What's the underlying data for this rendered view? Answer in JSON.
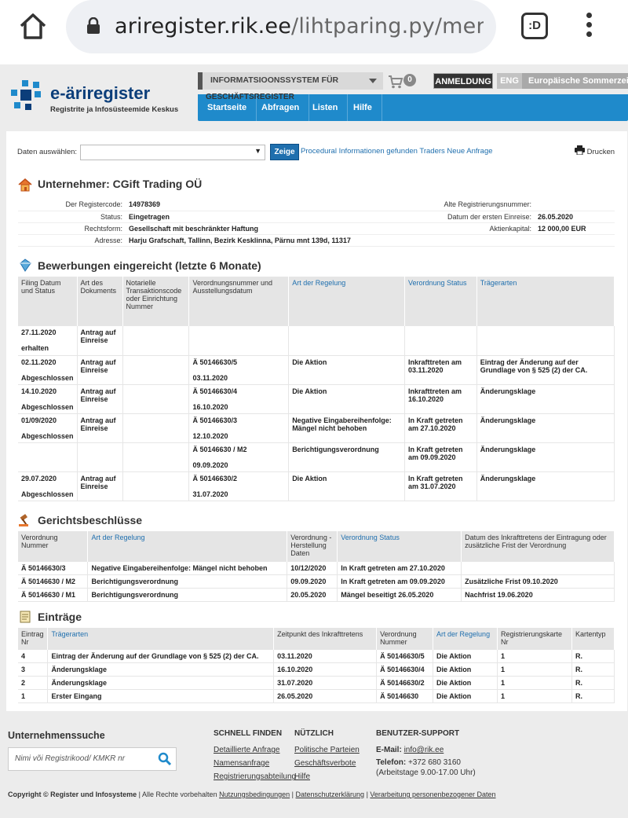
{
  "browser": {
    "url_host": "ariregister.rik.ee",
    "url_path": "/lihtparing.py/menet",
    "tabs_label": ":D"
  },
  "header": {
    "logo_title": "e-äriregister",
    "logo_subtitle": "Registrite ja Infosüsteemide Keskus",
    "system_select": "INFORMATSIOONSSYSTEM FÜR",
    "system_overflow": "GESCHÄFTSREGISTER",
    "cart_count": "0",
    "login_label": "ANMELDUNG",
    "lang_label": "ENG",
    "timezone_label": "Europäische Sommerzeit",
    "nav": [
      "Startseite",
      "Abfragen",
      "Listen",
      "Hilfe"
    ]
  },
  "toolbar": {
    "select_label": "Daten auswählen:",
    "select_value": "",
    "show_label": "Zeige",
    "links": "Procedural Informationen gefunden Traders Neue Anfrage",
    "print_label": "Drucken"
  },
  "company": {
    "title": "Unternehmer: CGift Trading OÜ",
    "rows": [
      {
        "l1": "Der Registercode:",
        "v1": "14978369",
        "l2": "Alte Registrierungsnummer:",
        "v2": ""
      },
      {
        "l1": "Status:",
        "v1": "Eingetragen",
        "l2": "Datum der ersten Einreise:",
        "v2": "26.05.2020"
      },
      {
        "l1": "Rechtsform:",
        "v1": "Gesellschaft mit beschränkter Haftung",
        "l2": "Aktienkapital:",
        "v2": "12 000,00 EUR"
      },
      {
        "l1": "Adresse:",
        "v1": "Harju Grafschaft, Tallinn, Bezirk Kesklinna, Pärnu mnt 139d, 11317",
        "l2": "",
        "v2": ""
      }
    ]
  },
  "applications": {
    "title": "Bewerbungen eingereicht (letzte 6 Monate)",
    "headers": [
      "Filing Datum und Status",
      "Art des Dokuments",
      "Notarielle Transaktionscode oder Einrichtung Nummer",
      "Verordnungsnummer und Ausstellungsdatum",
      "Art der Regelung",
      "Verordnung Status",
      "Trägerarten"
    ],
    "rows": [
      {
        "date": "27.11.2020",
        "status": "erhalten",
        "doc": "Antrag auf Einreise",
        "notary": "",
        "reg_no": "",
        "reg_date": "",
        "type": "",
        "reg_status": "",
        "carrier": ""
      },
      {
        "date": "02.11.2020",
        "status": "Abgeschlossen",
        "doc": "Antrag auf Einreise",
        "notary": "",
        "reg_no": "Ä 50146630/5",
        "reg_date": "03.11.2020",
        "type": "Die Aktion",
        "reg_status": "Inkrafttreten am 03.11.2020",
        "carrier": "Eintrag der Änderung auf der Grundlage von § 525 (2) der CA."
      },
      {
        "date": "14.10.2020",
        "status": "Abgeschlossen",
        "doc": "Antrag auf Einreise",
        "notary": "",
        "reg_no": "Ä 50146630/4",
        "reg_date": "16.10.2020",
        "type": "Die Aktion",
        "reg_status": "Inkrafttreten am 16.10.2020",
        "carrier": "Änderungsklage"
      },
      {
        "date": "01/09/2020",
        "status": "Abgeschlossen",
        "doc": "Antrag auf Einreise",
        "notary": "",
        "reg_no": "Ä 50146630/3",
        "reg_date": "12.10.2020",
        "type": "Negative Eingabereihenfolge: Mängel nicht behoben",
        "reg_status": "In Kraft getreten am 27.10.2020",
        "carrier": "Änderungsklage"
      },
      {
        "date": "",
        "status": "",
        "doc": "",
        "notary": "",
        "reg_no": "Ä 50146630 / M2",
        "reg_date": "09.09.2020",
        "type": "Berichtigungsverordnung",
        "reg_status": "In Kraft getreten am 09.09.2020",
        "carrier": "Änderungsklage"
      },
      {
        "date": "29.07.2020",
        "status": "Abgeschlossen",
        "doc": "Antrag auf Einreise",
        "notary": "",
        "reg_no": "Ä 50146630/2",
        "reg_date": "31.07.2020",
        "type": "Die Aktion",
        "reg_status": "In Kraft getreten am 31.07.2020",
        "carrier": "Änderungsklage"
      }
    ]
  },
  "court": {
    "title": "Gerichtsbeschlüsse",
    "headers": [
      "Verordnung Nummer",
      "Art der Regelung",
      "Verordnung -Herstellung Daten",
      "Verordnung Status",
      "Datum des Inkrafttretens der Eintragung oder zusätzliche Frist der Verordnung"
    ],
    "rows": [
      {
        "no": "Ä 50146630/3",
        "type": "Negative Eingabereihenfolge: Mängel nicht behoben",
        "date": "10/12/2020",
        "status": "In Kraft getreten am 27.10.2020",
        "deadline": ""
      },
      {
        "no": "Ä 50146630 / M2",
        "type": "Berichtigungsverordnung",
        "date": "09.09.2020",
        "status": "In Kraft getreten am 09.09.2020",
        "deadline": "Zusätzliche Frist 09.10.2020"
      },
      {
        "no": "Ä 50146630 / M1",
        "type": "Berichtigungsverordnung",
        "date": "20.05.2020",
        "status": "Mängel beseitigt 26.05.2020",
        "deadline": "Nachfrist 19.06.2020"
      }
    ]
  },
  "entries": {
    "title": "Einträge",
    "headers": [
      "Eintrag Nr",
      "Trägerarten",
      "Zeitpunkt des Inkrafttretens",
      "Verordnung Nummer",
      "Art der Regelung",
      "Registrierungskarte Nr",
      "Kartentyp"
    ],
    "rows": [
      {
        "nr": "4",
        "carrier": "Eintrag der Änderung auf der Grundlage von § 525 (2) der CA.",
        "date": "03.11.2020",
        "reg_no": "Ä 50146630/5",
        "type": "Die Aktion",
        "card": "1",
        "kind": "R."
      },
      {
        "nr": "3",
        "carrier": "Änderungsklage",
        "date": "16.10.2020",
        "reg_no": "Ä 50146630/4",
        "type": "Die Aktion",
        "card": "1",
        "kind": "R."
      },
      {
        "nr": "2",
        "carrier": "Änderungsklage",
        "date": "31.07.2020",
        "reg_no": "Ä 50146630/2",
        "type": "Die Aktion",
        "card": "1",
        "kind": "R."
      },
      {
        "nr": "1",
        "carrier": "Erster Eingang",
        "date": "26.05.2020",
        "reg_no": "Ä 50146630",
        "type": "Die Aktion",
        "card": "1",
        "kind": "R."
      }
    ]
  },
  "footer": {
    "search_title": "Unternehmenssuche",
    "search_placeholder": "Nimi või Registrikood/ KMKR nr",
    "col1_title": "SCHNELL FINDEN",
    "col1_links": [
      "Detaillierte Anfrage",
      "Namensanfrage",
      "Registrierungsabteilung"
    ],
    "col2_title": "NÜTZLICH",
    "col2_links": [
      "Politische Parteien",
      "Geschäftsverbote",
      "Hilfe"
    ],
    "col3_title": "BENUTZER-SUPPORT",
    "email_label": "E-Mail:",
    "email_value": "info@rik.ee",
    "phone_label": "Telefon:",
    "phone_value": "+372 680 3160",
    "hours": "(Arbeitstage 9.00-17.00 Uhr)",
    "copyright_bold": "Copyright © Register und Infosysteme",
    "rights": "| Alle Rechte vorbehalten",
    "legal_links": [
      "Nutzungsbedingungen",
      "Datenschutzerklärung",
      "Verarbeitung personenbezogener Daten"
    ]
  }
}
